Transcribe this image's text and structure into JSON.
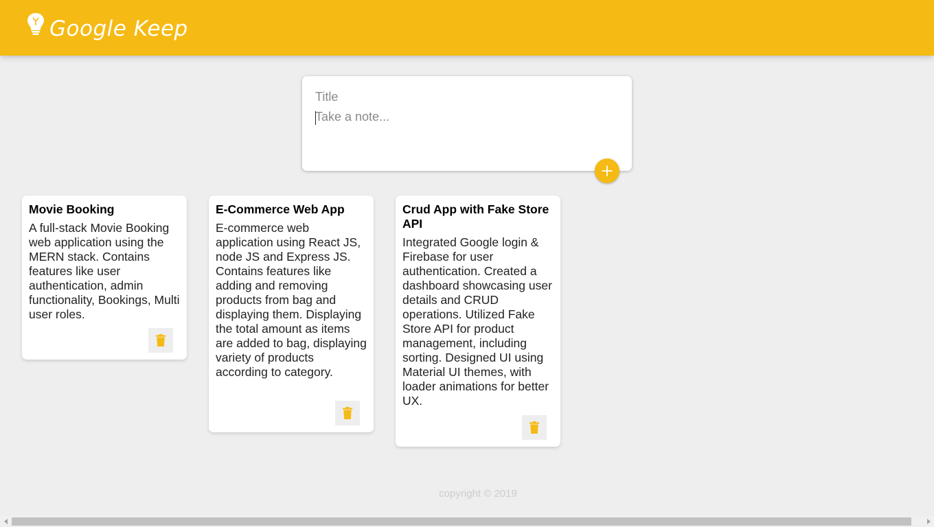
{
  "header": {
    "logo_icon": "lightbulb-icon",
    "title": "Google Keep",
    "brand_color": "#f5ba13"
  },
  "create_note": {
    "title_placeholder": "Title",
    "content_placeholder": "Take a note...",
    "title_value": "",
    "content_value": "",
    "add_icon": "plus-icon"
  },
  "notes": [
    {
      "title": "Movie Booking",
      "content": "A full-stack Movie Booking web application using the MERN stack. Contains features like user authentication, admin functionality, Bookings, Multi user roles.",
      "delete_icon": "trash-icon"
    },
    {
      "title": "E-Commerce Web App",
      "content": "E-commerce web application using React JS, node JS and Express JS. Contains features like adding and removing products from bag and displaying them. Displaying the total amount as items are added to bag, displaying variety of products according to category.",
      "delete_icon": "trash-icon"
    },
    {
      "title": "Crud App with Fake Store API",
      "content": "Integrated Google login & Firebase for user authentication. Created a dashboard showcasing user details and CRUD operations. Utilized Fake Store API for product management, including sorting. Designed UI using Material UI themes, with loader animations for better UX.",
      "delete_icon": "trash-icon"
    }
  ],
  "footer": {
    "copyright": "copyright © 2019"
  }
}
